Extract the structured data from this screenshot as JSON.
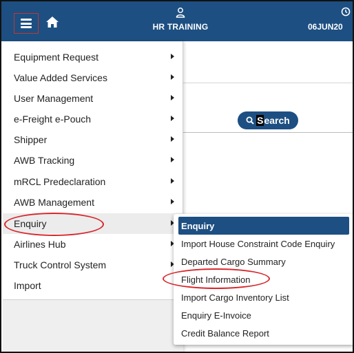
{
  "header": {
    "title": "HR TRAINING",
    "date": "06JUN20",
    "menu_icon": "hamburger-menu-icon",
    "home_icon": "home-icon",
    "user_icon": "user-icon",
    "clock_icon": "clock-icon",
    "bg_color": "#1d4f82"
  },
  "search": {
    "icon": "search-icon",
    "label_first": "S",
    "label_rest": "earch"
  },
  "main_menu": {
    "items": [
      {
        "label": "Equipment Request"
      },
      {
        "label": "Value Added Services"
      },
      {
        "label": "User Management"
      },
      {
        "label": "e-Freight e-Pouch"
      },
      {
        "label": "Shipper"
      },
      {
        "label": "AWB Tracking"
      },
      {
        "label": "mRCL Predeclaration"
      },
      {
        "label": "AWB Management"
      },
      {
        "label": "Enquiry"
      },
      {
        "label": "Airlines Hub"
      },
      {
        "label": "Truck Control System"
      },
      {
        "label": "Import"
      }
    ]
  },
  "sub_menu": {
    "items": [
      {
        "label": "Enquiry"
      },
      {
        "label": "Import House Constraint Code Enquiry"
      },
      {
        "label": "Departed Cargo Summary"
      },
      {
        "label": "Flight Information"
      },
      {
        "label": "Import Cargo Inventory List"
      },
      {
        "label": "Enquiry E-Invoice"
      },
      {
        "label": "Credit Balance Report"
      }
    ]
  },
  "colors": {
    "accent": "#1d4f82",
    "annotation": "#d8262b",
    "active_row": "#ececec"
  }
}
